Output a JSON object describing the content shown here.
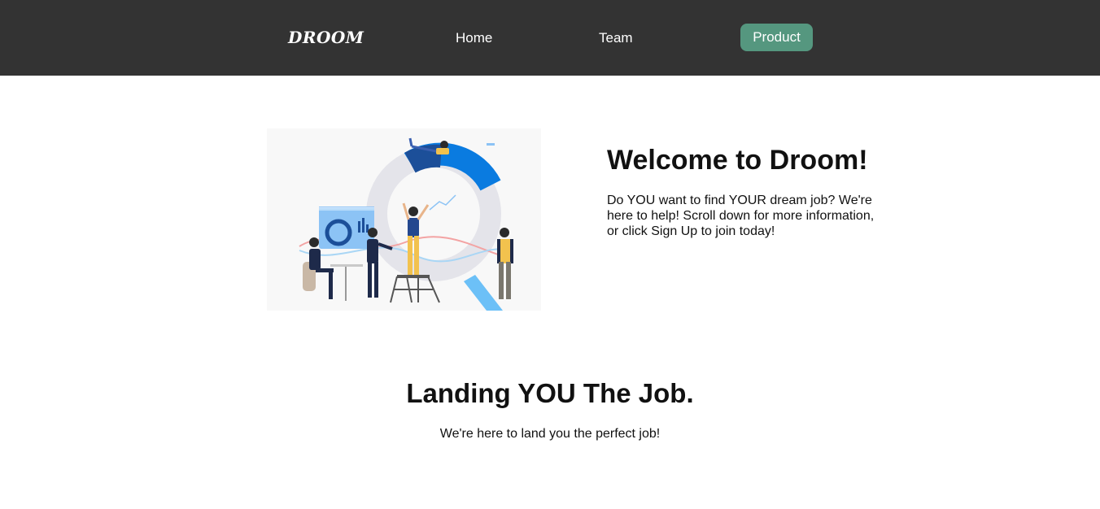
{
  "nav": {
    "logo": "DROOM",
    "home": "Home",
    "team": "Team",
    "product": "Product"
  },
  "colors": {
    "navbar": "#333333",
    "accent": "#55977f",
    "illustration_blue": "#0a7be0",
    "illustration_yellow": "#f2c24e"
  },
  "hero": {
    "title": "Welcome to Droom!",
    "text": "Do YOU want to find YOUR dream job? We're here to help! Scroll down for more information, or click Sign Up to join today!"
  },
  "section": {
    "title": "Landing YOU The Job.",
    "text": "We're here to land you the perfect job!"
  }
}
